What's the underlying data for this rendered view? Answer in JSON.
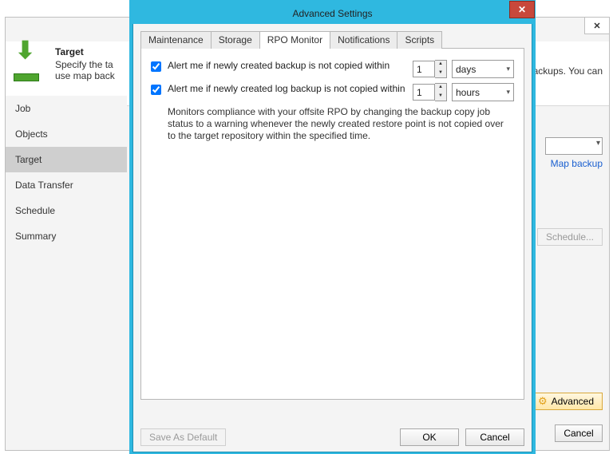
{
  "back": {
    "close_glyph": "✕",
    "header_title": "Target",
    "header_desc_line1": "Specify the ta",
    "header_desc_line2": "use map back",
    "right_fragment": "backups. You can",
    "map_backup": "Map backup",
    "schedule_btn": "Schedule...",
    "advanced_btn": "Advanced",
    "cancel_btn": "Cancel"
  },
  "sidebar": {
    "steps": [
      "Job",
      "Objects",
      "Target",
      "Data Transfer",
      "Schedule",
      "Summary"
    ],
    "active_index": 2
  },
  "modal": {
    "title": "Advanced Settings",
    "close_glyph": "✕",
    "tabs": [
      "Maintenance",
      "Storage",
      "RPO Monitor",
      "Notifications",
      "Scripts"
    ],
    "active_tab_index": 2,
    "rpo": {
      "opt1_checked": true,
      "opt1_label": "Alert me if newly created backup is not copied within",
      "opt1_value": "1",
      "opt1_unit": "days",
      "opt2_checked": true,
      "opt2_label": "Alert me if newly created log backup is not copied within",
      "opt2_value": "1",
      "opt2_unit": "hours",
      "desc": "Monitors compliance with your offsite RPO by changing the backup copy job status to a warning whenever the newly created restore point is not copied over to the target repository within the specified time."
    },
    "footer": {
      "save_default": "Save As Default",
      "ok": "OK",
      "cancel": "Cancel"
    }
  }
}
